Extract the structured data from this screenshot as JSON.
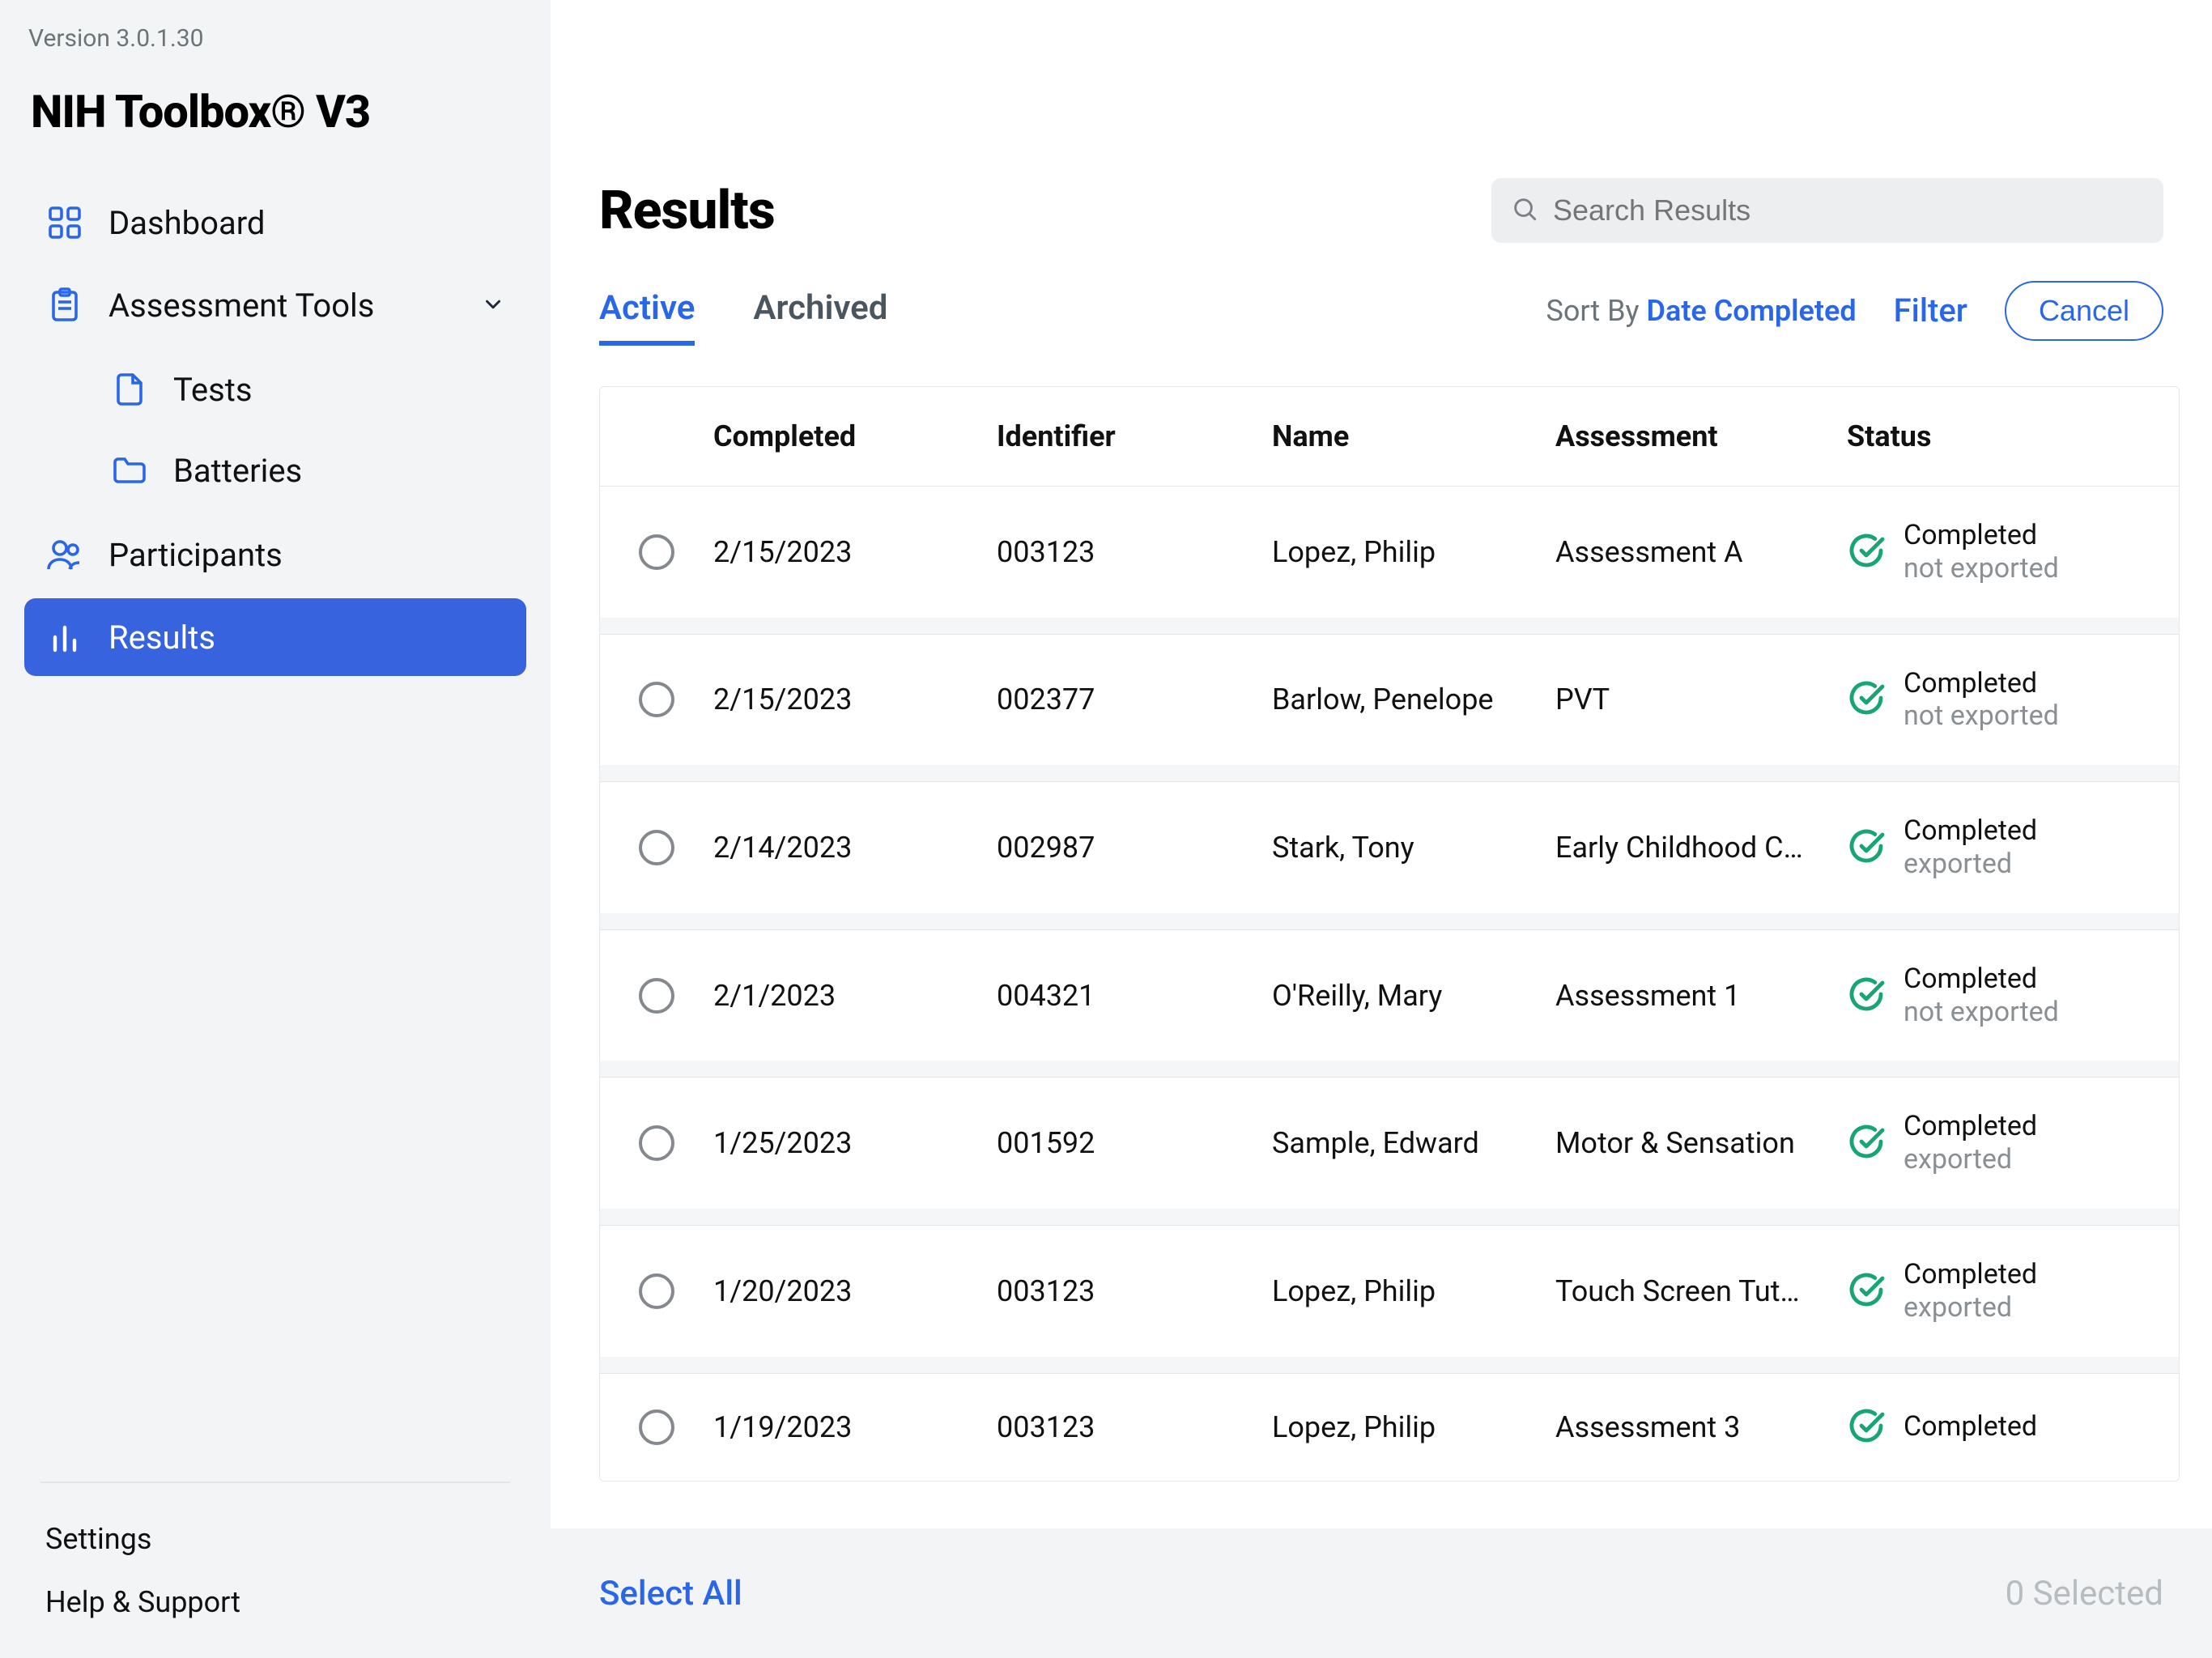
{
  "version": "Version 3.0.1.30",
  "app_title": "NIH Toolbox® V3",
  "sidebar": {
    "items": [
      {
        "label": "Dashboard"
      },
      {
        "label": "Assessment Tools"
      },
      {
        "label": "Tests"
      },
      {
        "label": "Batteries"
      },
      {
        "label": "Participants"
      },
      {
        "label": "Results"
      }
    ],
    "footer": {
      "settings": "Settings",
      "help": "Help & Support"
    }
  },
  "page": {
    "title": "Results",
    "search_placeholder": "Search Results",
    "tabs": {
      "active": "Active",
      "archived": "Archived"
    },
    "sort_label": "Sort By",
    "sort_value": "Date Completed",
    "filter": "Filter",
    "cancel": "Cancel",
    "select_all": "Select All",
    "selected_count": "0 Selected",
    "columns": {
      "completed": "Completed",
      "identifier": "Identifier",
      "name": "Name",
      "assessment": "Assessment",
      "status": "Status"
    },
    "rows": [
      {
        "completed": "2/15/2023",
        "identifier": "003123",
        "name": "Lopez, Philip",
        "assessment": "Assessment A",
        "status": "Completed",
        "sub": "not exported"
      },
      {
        "completed": "2/15/2023",
        "identifier": "002377",
        "name": "Barlow, Penelope",
        "assessment": "PVT",
        "status": "Completed",
        "sub": "not exported"
      },
      {
        "completed": "2/14/2023",
        "identifier": "002987",
        "name": "Stark, Tony",
        "assessment": "Early Childhood C…",
        "status": "Completed",
        "sub": "exported"
      },
      {
        "completed": "2/1/2023",
        "identifier": "004321",
        "name": "O'Reilly, Mary",
        "assessment": "Assessment 1",
        "status": "Completed",
        "sub": "not exported"
      },
      {
        "completed": "1/25/2023",
        "identifier": "001592",
        "name": "Sample, Edward",
        "assessment": "Motor & Sensation",
        "status": "Completed",
        "sub": "exported"
      },
      {
        "completed": "1/20/2023",
        "identifier": "003123",
        "name": "Lopez, Philip",
        "assessment": "Touch Screen Tut…",
        "status": "Completed",
        "sub": "exported"
      },
      {
        "completed": "1/19/2023",
        "identifier": "003123",
        "name": "Lopez, Philip",
        "assessment": "Assessment 3",
        "status": "Completed",
        "sub": ""
      }
    ]
  },
  "colors": {
    "accent": "#2a66e8",
    "nav_active_bg": "#3763df",
    "status_ok": "#17a673"
  }
}
